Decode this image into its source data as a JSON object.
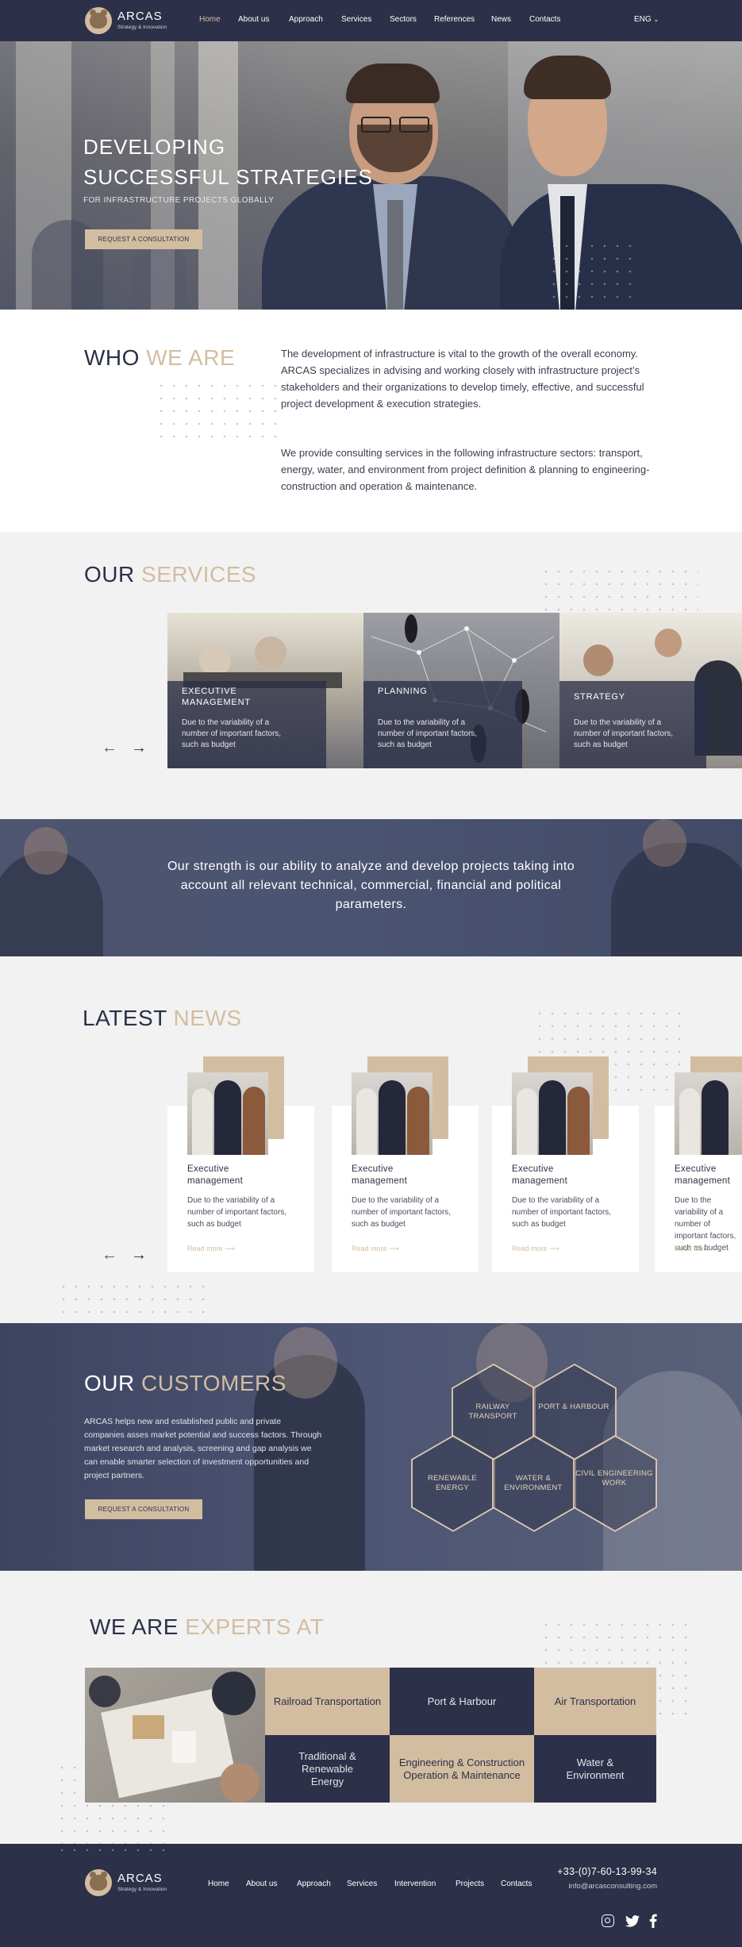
{
  "header": {
    "brand": "ARCAS",
    "tagline": "Strategy & Innovation",
    "nav": [
      "Home",
      "About us",
      "Approach",
      "Services",
      "Sectors",
      "References",
      "News",
      "Contacts"
    ],
    "language": "ENG"
  },
  "hero": {
    "line1": "DEVELOPING",
    "line2": "SUCCESSFUL STRATEGIES",
    "subtitle": "FOR INFRASTRUCTURE PROJECTS GLOBALLY",
    "cta": "REQUEST A CONSULTATION"
  },
  "who": {
    "title_a": "WHO",
    "title_b": "WE ARE",
    "para1": "The development of infrastructure is vital to the growth of the overall economy. ARCAS specializes in advising and working closely with infrastructure project’s stakeholders and their organizations to develop timely, effective, and successful project development & execution strategies.",
    "para2": "We provide consulting services in the following infrastructure sectors: transport, energy, water, and environment from project definition & planning to engineering-construction and operation & maintenance."
  },
  "services": {
    "title_a": "OUR",
    "title_b": "SERVICES",
    "cards": [
      {
        "title": "EXECUTIVE MANAGEMENT",
        "desc": "Due to the variability of a number of important factors, such as budget"
      },
      {
        "title": "PLANNING",
        "desc": "Due to the variability of a number of important factors, such as budget"
      },
      {
        "title": "STRATEGY",
        "desc": "Due to the variability of a number of important factors, such as budget"
      }
    ]
  },
  "banner": {
    "text": "Our strength is our ability to analyze and develop projects taking into account all relevant technical, commercial, financial and political parameters."
  },
  "news": {
    "title_a": "LATEST",
    "title_b": "NEWS",
    "items": [
      {
        "title": "Executive management",
        "desc": "Due to the variability of a number of important factors, such as budget",
        "more": "Read more"
      },
      {
        "title": "Executive management",
        "desc": "Due to the variability of a number of important factors, such as budget",
        "more": "Read more"
      },
      {
        "title": "Executive management",
        "desc": "Due to the variability of a number of important factors, such as budget",
        "more": "Read more"
      },
      {
        "title": "Executive management",
        "desc": "Due to the variability of a number of important factors, such as budget",
        "more": "Read more"
      }
    ]
  },
  "customers": {
    "title_a": "OUR",
    "title_b": "CUSTOMERS",
    "text": "ARCAS helps new and established public and private companies asses market potential and success factors. Through market research and analysis, screening and gap analysis we can enable smarter selection of investment opportunities and project partners.",
    "cta": "REQUEST A CONSULTATION",
    "hexes": [
      "RAILWAY TRANSPORT",
      "PORT & HARBOUR",
      "RENEWABLE ENERGY",
      "WATER & ENVIRONMENT",
      "CIVIL ENGINEERING WORK"
    ]
  },
  "experts": {
    "title_a": "WE ARE",
    "title_b": "EXPERTS AT",
    "cells": [
      "Railroad Transportation",
      "Port & Harbour",
      "Air Transportation",
      "Traditional & Renewable Energy",
      "Engineering & Construction Operation & Maintenance",
      "Water & Environment"
    ]
  },
  "footer": {
    "brand": "ARCAS",
    "tagline": "Strategy & Innovation",
    "nav": [
      "Home",
      "About us",
      "Approach",
      "Services",
      "Intervention",
      "Projects",
      "Contacts"
    ],
    "phone": "+33-(0)7-60-13-99-34",
    "email": "info@arcasconsulting.com"
  },
  "colors": {
    "navy": "#2c3048",
    "accent": "#d3bda1",
    "background": "#f2f2f2"
  },
  "icons": [
    "logo-icon",
    "chevron-down-icon",
    "arrow-left-icon",
    "arrow-right-icon",
    "instagram-icon",
    "twitter-icon",
    "facebook-icon"
  ]
}
